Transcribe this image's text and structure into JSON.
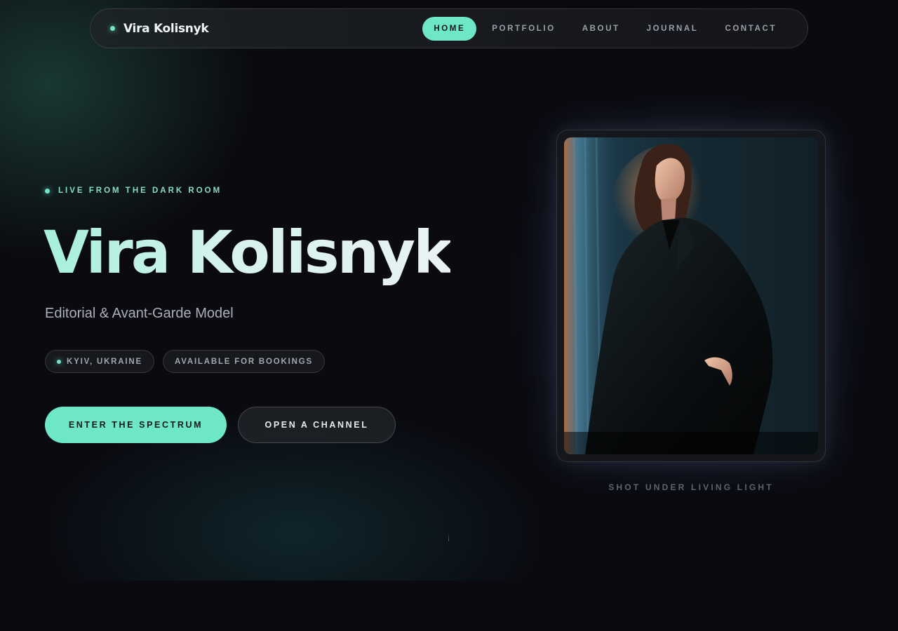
{
  "nav": {
    "brand": "Vira Kolisnyk",
    "links": [
      {
        "label": "HOME",
        "active": true
      },
      {
        "label": "PORTFOLIO",
        "active": false
      },
      {
        "label": "ABOUT",
        "active": false
      },
      {
        "label": "JOURNAL",
        "active": false
      },
      {
        "label": "CONTACT",
        "active": false
      }
    ]
  },
  "hero": {
    "eyebrow": "LIVE FROM THE DARK ROOM",
    "title": "Vira Kolisnyk",
    "subtitle": "Editorial & Avant-Garde Model",
    "chips": [
      {
        "label": "KYIV, UKRAINE",
        "icon": "status-dot"
      },
      {
        "label": "AVAILABLE FOR BOOKINGS"
      }
    ],
    "primary_cta": "ENTER THE SPECTRUM",
    "secondary_cta": "OPEN A CHANNEL"
  },
  "portrait": {
    "caption": "SHOT UNDER LIVING LIGHT"
  },
  "colors": {
    "accent": "#6ee6c8",
    "background": "#0a0a10"
  }
}
